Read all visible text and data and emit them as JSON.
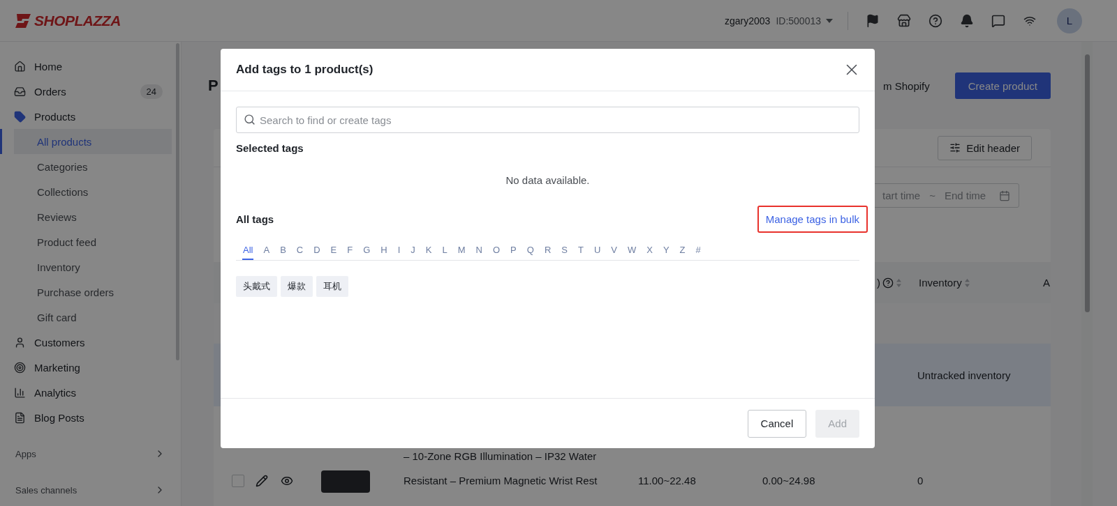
{
  "topbar": {
    "logo": "SHOPLAZZA",
    "account_name": "zgary2003",
    "account_id": "ID:500013",
    "avatar": "L"
  },
  "sidebar": {
    "items": [
      {
        "label": "Home",
        "selected": false
      },
      {
        "label": "Orders",
        "badge": "24",
        "selected": false
      },
      {
        "label": "Products",
        "selected": true,
        "expanded": true,
        "children": [
          {
            "label": "All products",
            "selected": true
          },
          {
            "label": "Categories",
            "selected": false
          },
          {
            "label": "Collections",
            "selected": false
          },
          {
            "label": "Reviews",
            "selected": false
          },
          {
            "label": "Product feed",
            "selected": false
          },
          {
            "label": "Inventory",
            "selected": false
          },
          {
            "label": "Purchase orders",
            "selected": false
          },
          {
            "label": "Gift card",
            "selected": false
          }
        ]
      },
      {
        "label": "Customers",
        "selected": false
      },
      {
        "label": "Marketing",
        "selected": false
      },
      {
        "label": "Analytics",
        "selected": false
      },
      {
        "label": "Blog Posts",
        "selected": false
      }
    ],
    "sections": [
      {
        "label": "Apps"
      },
      {
        "label": "Sales channels"
      }
    ]
  },
  "page": {
    "title": "P",
    "import_link": "m Shopify",
    "create_button": "Create product",
    "edit_header": "Edit header",
    "date_range": {
      "start": "tart time",
      "separator": "~",
      "end": "End time"
    },
    "table": {
      "columns": [
        {
          "label": ")",
          "help": true,
          "sortable": true
        },
        {
          "label": "Inventory",
          "help": false,
          "sortable": true
        },
        {
          "label": "A",
          "help": false,
          "sortable": false
        }
      ],
      "rows": [
        {
          "selected": true,
          "inventory": "Untracked inventory"
        },
        {
          "selected": false,
          "checked": false,
          "title_lines": [
            "– 10-Zone RGB Illumination – IP32 Water",
            "Resistant – Premium Magnetic Wrist Rest"
          ],
          "price": "11.00~22.48",
          "compare_price": "0.00~24.98",
          "inventory": "0"
        }
      ]
    }
  },
  "modal": {
    "title": "Add tags to 1 product(s)",
    "search": {
      "placeholder": "Search to find or create tags"
    },
    "selected_tags": {
      "heading": "Selected tags",
      "empty": "No data available."
    },
    "all_tags": {
      "heading": "All tags",
      "manage_link": "Manage tags in bulk",
      "letters": [
        {
          "label": "All",
          "selected": true
        },
        {
          "label": "A",
          "selected": false
        },
        {
          "label": "B",
          "selected": false
        },
        {
          "label": "C",
          "selected": false
        },
        {
          "label": "D",
          "selected": false
        },
        {
          "label": "E",
          "selected": false
        },
        {
          "label": "F",
          "selected": false
        },
        {
          "label": "G",
          "selected": false
        },
        {
          "label": "H",
          "selected": false
        },
        {
          "label": "I",
          "selected": false
        },
        {
          "label": "J",
          "selected": false
        },
        {
          "label": "K",
          "selected": false
        },
        {
          "label": "L",
          "selected": false
        },
        {
          "label": "M",
          "selected": false
        },
        {
          "label": "N",
          "selected": false
        },
        {
          "label": "O",
          "selected": false
        },
        {
          "label": "P",
          "selected": false
        },
        {
          "label": "Q",
          "selected": false
        },
        {
          "label": "R",
          "selected": false
        },
        {
          "label": "S",
          "selected": false
        },
        {
          "label": "T",
          "selected": false
        },
        {
          "label": "U",
          "selected": false
        },
        {
          "label": "V",
          "selected": false
        },
        {
          "label": "W",
          "selected": false
        },
        {
          "label": "X",
          "selected": false
        },
        {
          "label": "Y",
          "selected": false
        },
        {
          "label": "Z",
          "selected": false
        },
        {
          "label": "#",
          "selected": false
        }
      ],
      "tags": [
        "头戴式",
        "爆款",
        "耳机"
      ]
    },
    "buttons": [
      {
        "label": "Cancel",
        "kind": "secondary",
        "disabled": false
      },
      {
        "label": "Add",
        "kind": "primary",
        "disabled": true
      }
    ]
  }
}
